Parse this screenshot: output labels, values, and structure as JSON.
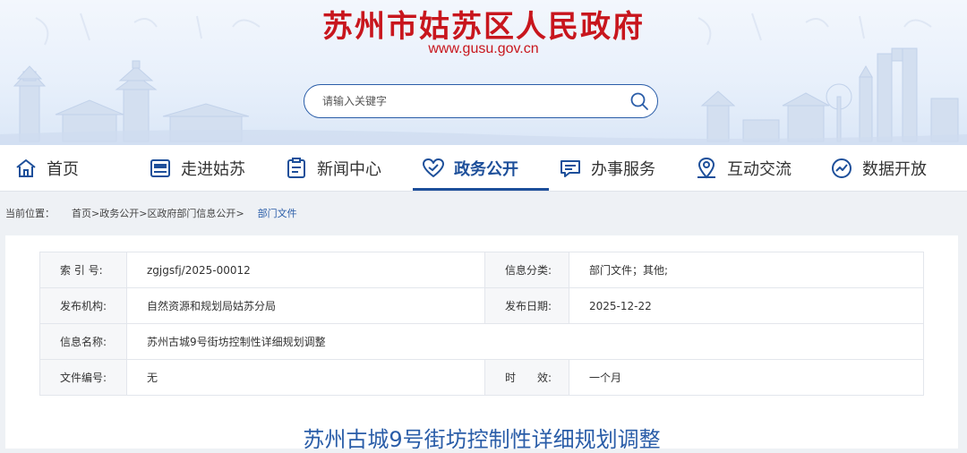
{
  "header": {
    "site_title": "苏州市姑苏区人民政府",
    "site_url": "www.gusu.gov.cn",
    "search_placeholder": "请输入关键字"
  },
  "nav": {
    "items": [
      {
        "label": "首页",
        "icon": "home-icon"
      },
      {
        "label": "走进姑苏",
        "icon": "news-card-icon"
      },
      {
        "label": "新闻中心",
        "icon": "clipboard-icon"
      },
      {
        "label": "政务公开",
        "icon": "heart-icon",
        "active": true
      },
      {
        "label": "办事服务",
        "icon": "chat-icon"
      },
      {
        "label": "互动交流",
        "icon": "map-pin-icon"
      },
      {
        "label": "数据开放",
        "icon": "chart-circle-icon"
      }
    ]
  },
  "breadcrumb": {
    "prefix": "当前位置：",
    "items": [
      "首页",
      "政务公开",
      "区政府部门信息公开"
    ],
    "separator": ">",
    "current": "部门文件"
  },
  "info": {
    "rows": [
      {
        "label1": "索 引 号:",
        "value1": "zgjgsfj/2025-00012",
        "label2": "信息分类:",
        "value2": "部门文件；其他;"
      },
      {
        "label1": "发布机构:",
        "value1": "自然资源和规划局姑苏分局",
        "label2": "发布日期:",
        "value2": "2025-12-22"
      },
      {
        "label1": "信息名称:",
        "value1": "苏州古城9号街坊控制性详细规划调整"
      },
      {
        "label1": "文件编号:",
        "value1": "无",
        "label2": "时　　效:",
        "value2": "一个月"
      }
    ]
  },
  "document": {
    "title": "苏州古城9号街坊控制性详细规划调整"
  },
  "colors": {
    "brand_red": "#c8161d",
    "brand_blue": "#1d4f9a",
    "link_blue": "#2a5da8"
  }
}
